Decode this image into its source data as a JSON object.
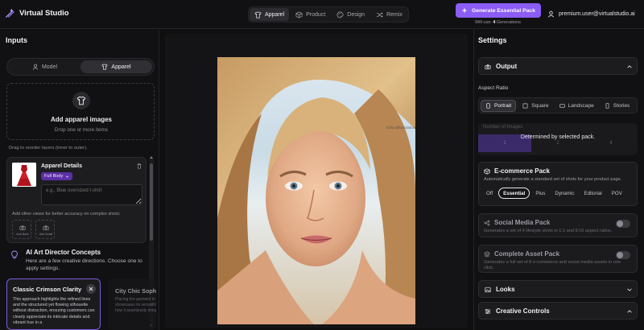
{
  "app": {
    "name": "Virtual Studio"
  },
  "nav": {
    "tabs": [
      {
        "label": "Apparel"
      },
      {
        "label": "Product"
      },
      {
        "label": "Design"
      },
      {
        "label": "Remix"
      }
    ]
  },
  "header": {
    "generate_label": "Generate Essential Pack",
    "will_use_prefix": "Will use:",
    "will_use_count": "4",
    "will_use_suffix": "Generations",
    "user_email": "premium.user@virtualstudio.ai"
  },
  "inputs": {
    "title": "Inputs",
    "modes": [
      {
        "label": "Model"
      },
      {
        "label": "Apparel"
      }
    ],
    "active_mode": "Apparel",
    "upload": {
      "title": "Add apparel images",
      "subtitle": "Drop one or more items"
    },
    "reorder_hint": "Drag to reorder layers (inner to outer).",
    "apparel_details": {
      "title": "Apparel Details",
      "fit": "Full Body",
      "description_placeholder": "e.g., Blue oversized t-shirt",
      "views_hint": "Add other views for better accuracy on complex shots:",
      "view_slots": [
        {
          "label": "Add Back"
        },
        {
          "label": "Add Detail"
        }
      ]
    }
  },
  "concepts": {
    "title": "AI Art Director Concepts",
    "description": "Here are a few creative directions. Choose one to apply settings.",
    "cards": [
      {
        "title": "Classic Crimson Clarity",
        "text": "This approach highlights the refined lines and the structured yet flowing silhouette without distraction, ensuring customers can clearly appreciate its intricate details and vibrant hue in a"
      },
      {
        "title": "City Chic Sophistication",
        "text": "Placing the garment in a city environment showcases its versatility and chic demonstrating how it seamlessly integrates"
      }
    ]
  },
  "preview": {
    "watermark": "IG/lucidfoundation"
  },
  "settings": {
    "title": "Settings",
    "output": {
      "label": "Output"
    },
    "aspect_ratio": {
      "label": "Aspect Ratio",
      "options": [
        {
          "label": "Portrait"
        },
        {
          "label": "Square"
        },
        {
          "label": "Landscape"
        },
        {
          "label": "Stories"
        }
      ],
      "selected": "Portrait"
    },
    "number_of_images": {
      "label": "Number of Images",
      "values": [
        "1",
        "2",
        "4"
      ],
      "overlay": "Determined by selected pack."
    },
    "packs": [
      {
        "title": "E-commerce Pack",
        "description": "Automatically generate a standard set of shots for your product page.",
        "options": [
          {
            "label": "Off"
          },
          {
            "label": "Essential"
          },
          {
            "label": "Plus"
          },
          {
            "label": "Dynamic"
          },
          {
            "label": "Editorial"
          },
          {
            "label": "POV"
          }
        ],
        "selected": "Essential"
      },
      {
        "title": "Social Media Pack",
        "description": "Generates a set of 4 lifestyle shots in 1:1 and 9:16 aspect ratios.",
        "enabled": false
      },
      {
        "title": "Complete Asset Pack",
        "description": "Generates a full set of 8 e-commerce and social media assets in one click.",
        "enabled": false
      }
    ],
    "looks": {
      "label": "Looks"
    },
    "creative_controls": {
      "label": "Creative Controls"
    }
  },
  "colors": {
    "accent": "#8b5cf6",
    "background": "#0f0f10",
    "panel": "#1c1c1f"
  },
  "icons": [
    "wand-logo-icon",
    "shirt-icon",
    "box-icon",
    "palette-icon",
    "shuffle-icon",
    "sparkle-icon",
    "user-icon",
    "trash-icon",
    "chevron-down-icon",
    "camera-icon",
    "lightbulb-icon",
    "close-icon",
    "chevron-up-icon",
    "share-icon",
    "layers-icon",
    "sliders-icon"
  ]
}
